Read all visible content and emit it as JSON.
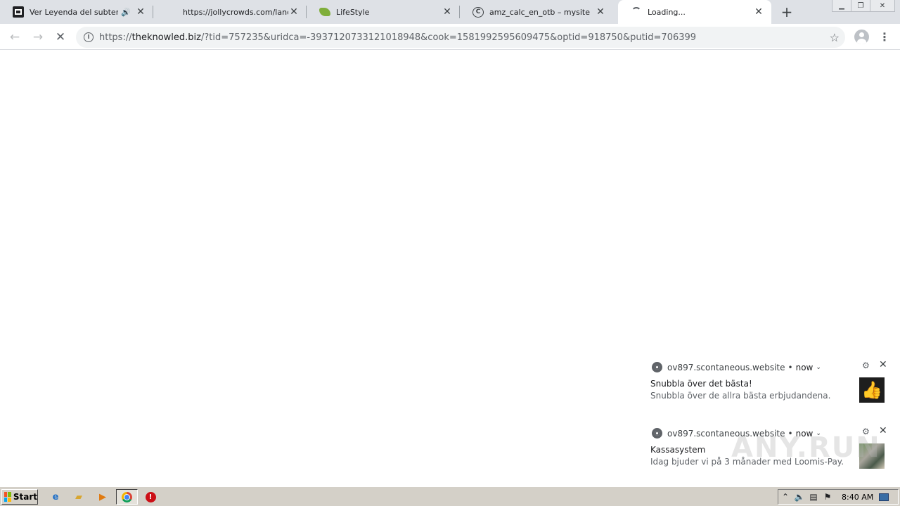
{
  "browser": {
    "tabs": [
      {
        "title": "Ver Leyenda del subterráneo",
        "favicon": "film-icon",
        "audio": true,
        "active": false
      },
      {
        "title": "https://jollycrowds.com/land/roulette",
        "favicon": "blank-icon",
        "audio": false,
        "active": false
      },
      {
        "title": "LifeStyle",
        "favicon": "leaf-icon",
        "audio": false,
        "active": false
      },
      {
        "title": "amz_calc_en_otb – mysite",
        "favicon": "c-icon",
        "audio": false,
        "active": false
      },
      {
        "title": "Loading...",
        "favicon": "loading-spinner-icon",
        "audio": false,
        "active": true
      }
    ],
    "new_tab_glyph": "+",
    "close_glyph": "✕",
    "url": {
      "scheme": "https://",
      "host": "theknowled.biz",
      "rest": "/?tid=757235&uridca=-3937120733121018948&cook=1581992595609475&optid=918750&putid=706399"
    },
    "info_glyph": "i",
    "star_glyph": "☆",
    "menu_glyph": "⋮"
  },
  "notifications": [
    {
      "origin": "ov897.scontaneous.website",
      "separator": "•",
      "when": "now",
      "title": "Snubbla över det bästa!",
      "body": "Snubbla över de allra bästa erbjudandena.",
      "image": "thumbs-up-image"
    },
    {
      "origin": "ov897.scontaneous.website",
      "separator": "•",
      "when": "now",
      "title": "Kassasystem",
      "body": "Idag bjuder vi på 3 månader med Loomis-Pay.",
      "image": "photo-image"
    }
  ],
  "watermark": "ANY.RUN",
  "taskbar": {
    "start_label": "Start",
    "clock": "8:40 AM"
  },
  "colors": {
    "tabstrip": "#dee1e6",
    "omnibox": "#f1f3f4",
    "taskbar": "#d4d0c8"
  }
}
